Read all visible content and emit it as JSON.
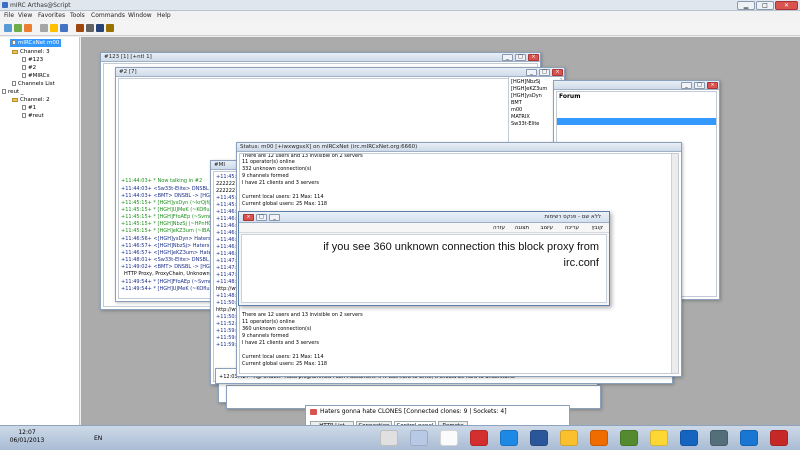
{
  "window": {
    "title": "mIRC Arthas@Script"
  },
  "menu": [
    "File",
    "View",
    "Favorites",
    "Tools",
    "Commands",
    "Window",
    "Help"
  ],
  "tree": {
    "server1": "mIRCxNet m00",
    "channels1": "Channel: 3",
    "ch1": [
      "#123",
      "#2",
      "#MIRCx"
    ],
    "list": "Channels List",
    "server2": "reut _",
    "channels2": "Channel: 2",
    "ch2": [
      "#1",
      "#reut"
    ]
  },
  "win123": {
    "title": "#123 [1] [+ntl 1]"
  },
  "win2": {
    "title": "#2 [7]",
    "nicks": [
      "[HGH]NbzSj",
      "[HGH]eKZ3um",
      "[HGH]ysDyn",
      "BMT",
      "m00",
      "MATRIX",
      "Sw33t-Elite"
    ],
    "forum": "Forum",
    "lines": [
      "+11:44:03+ * Now talking in #2",
      "+11:44:03+ <Sw33t-Elite> DNSBL ->",
      "+11:44:03+ <BMT> DNSBL -> [HGH]",
      "+11:45:15+ * [HGH]ysDyn (~krQjf@2",
      "+11:45:15+ * [HGH]UJMeK (~KOflu@",
      "+11:45:15+ * [HGH]FfoAEp (~Svmmq",
      "+11:45:15+ * [HGH]NbzSj (~HPnHQ@",
      "+11:45:15+ * [HGH]eKZ3um (~IBAmyy",
      "+11:46:56+ <[HGH]ysDyn> Haters go",
      "+11:46:57+ <[HGH]NbzSj> Haters go",
      "+11:46:57+ <[HGH]eKZ3um> Haters g",
      "+11:48:01+ <Sw33t-Elite> DNSBL ->",
      "+11:49:02+ <BMT> DNSBL -> [HGH]",
      "HTTP Proxy, ProxyChain, Unknown,",
      "+11:49:54+ * [HGH]FfoAEp (~Svmmq",
      "+11:49:54+ * [HGH]UJMeK (~KOflu@"
    ]
  },
  "win3": {
    "title": "#MI",
    "lines": [
      "+11:45:4",
      "222222",
      "222222",
      "+11:45:4",
      "+11:45:4",
      "+11:46:1",
      "+11:46:1",
      "+11:46:1",
      "+11:46:5",
      "+11:46:5",
      "+11:46:5",
      "+11:46:5",
      "+11:47:1",
      "+11:47:1",
      "+11:47:2",
      "+11:48:0",
      "http://ww",
      "+11:48:0",
      "+11:50:5",
      "http://ww",
      "+11:50:5",
      "+11:52:4",
      "+11:59:1",
      "+11:59:1",
      "+11:59:5"
    ],
    "bottom": "+12:03:42+ <lgP0HBot> Hasu programmed i don't document. If it was hard to write, it should be hard to understand."
  },
  "status": {
    "title": "Status: m00 [+iwxwgsxX] on mIRCxNet (irc.mIRCxNet.org:6660)",
    "top": [
      "There are 12 users and 13 invisible on 2 servers",
      "11 operator(s) online",
      "332 unknown connection(s)",
      "9 channels formed",
      "I have 21 clients and 3 servers",
      "",
      "Current local users: 21 Max: 114",
      "Current global users: 25 Max: 118"
    ],
    "bottom": [
      "There are 12 users and 13 invisible on 2 servers",
      "11 operator(s) online",
      "360 unknown connection(s)",
      "9 channels formed",
      "I have 21 clients and 3 servers",
      "",
      "Current local users: 21 Max: 114",
      "Current global users: 25 Max: 118"
    ]
  },
  "editor": {
    "title": "ללא שם - פנקס רשימות",
    "menu": [
      "קובץ",
      "עריכה",
      "עיצוב",
      "תצוגה",
      "עזרה"
    ],
    "text1": "if you see 360 unknown connection this block proxy from",
    "text2": "irc.conf"
  },
  "clones": {
    "title": "Haters gonna hate CLONES [Connected clones: 9 | Sockets: 4]",
    "tabs": [
      "HTTP List",
      "Connection",
      "Control panel",
      "Remote"
    ]
  },
  "taskbar": {
    "time": "12:07",
    "date": "06/01/2013",
    "lang": "EN"
  }
}
